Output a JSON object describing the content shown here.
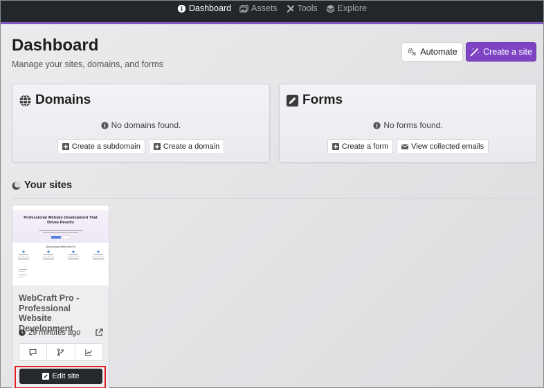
{
  "nav": {
    "items": [
      {
        "label": "Dashboard",
        "icon": "info-circle-icon",
        "active": true
      },
      {
        "label": "Assets",
        "icon": "images-icon",
        "active": false
      },
      {
        "label": "Tools",
        "icon": "tools-icon",
        "active": false
      },
      {
        "label": "Explore",
        "icon": "layers-icon",
        "active": false
      }
    ]
  },
  "header": {
    "title": "Dashboard",
    "subtitle": "Manage your sites, domains, and forms",
    "automate_label": "Automate",
    "create_site_label": "Create a site"
  },
  "domains": {
    "title": "Domains",
    "empty_text": "No domains found.",
    "create_subdomain_label": "Create a subdomain",
    "create_domain_label": "Create a domain"
  },
  "forms": {
    "title": "Forms",
    "empty_text": "No forms found.",
    "create_form_label": "Create a form",
    "view_emails_label": "View collected emails"
  },
  "sites": {
    "heading": "Your sites",
    "items": [
      {
        "title": "WebCraft Pro - Professional Website Development",
        "updated": "29 minutes ago",
        "edit_label": "Edit site",
        "thumbnail": {
          "hero_title": "Professional Website Development That Drives Results",
          "section_title": "Why choose WebCraft Pro"
        }
      }
    ]
  },
  "colors": {
    "nav_bg": "#23262a",
    "accent": "#7e44c4",
    "highlight": "#e02020",
    "edit_bg": "#25282c"
  }
}
